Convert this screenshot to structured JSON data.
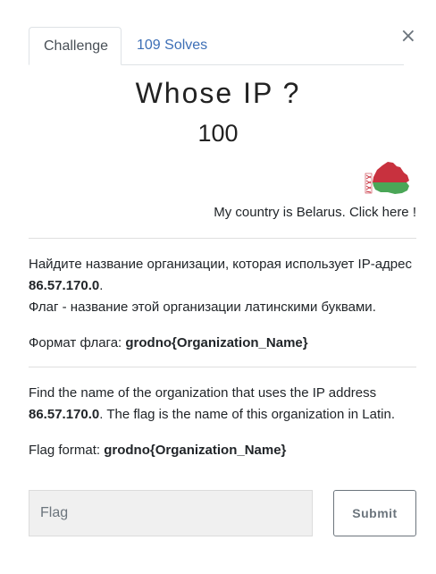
{
  "close_icon": "×",
  "tabs": [
    {
      "label": "Challenge",
      "active": true
    },
    {
      "label": "109 Solves",
      "active": false
    }
  ],
  "challenge": {
    "name": "Whose IP ?",
    "value": "100",
    "country_link": "My country is Belarus. Click here !",
    "flag_icon": "belarus-map-flag-icon",
    "ru": {
      "line1_a": "Найдите название организации, которая использует IP-адрес ",
      "line1_ip": "86.57.170.0",
      "line1_b": ".",
      "line2": "Флаг - название этой организации латинскими буквами.",
      "format_label": "Формат флага: ",
      "format_value": "grodno{Organization_Name}"
    },
    "en": {
      "line1_a": "Find the name of the organization that uses the IP address ",
      "line1_ip": "86.57.170.0",
      "line1_b": ". The flag is the name of this organization in Latin.",
      "format_label": "Flag format: ",
      "format_value": "grodno{Organization_Name}"
    }
  },
  "form": {
    "placeholder": "Flag",
    "value": "",
    "submit_label": "Submit"
  },
  "colors": {
    "link": "#3d6fb6",
    "flag_red": "#c8313e",
    "flag_green": "#4aa657"
  }
}
